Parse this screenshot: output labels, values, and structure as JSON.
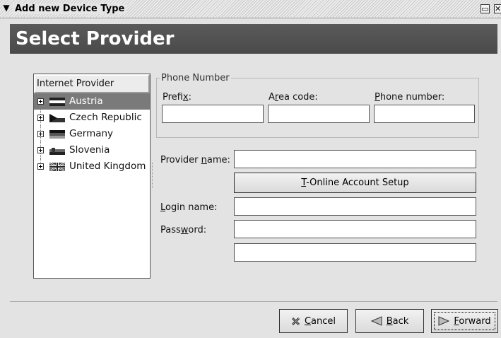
{
  "window": {
    "title": "Add new Device Type",
    "menu_icon": "chevron-down-icon",
    "maximize_icon": "maximize-icon",
    "close_icon": "close-icon"
  },
  "banner": {
    "title": "Select Provider"
  },
  "tree": {
    "header": "Internet Provider",
    "items": [
      {
        "label": "Austria",
        "selected": true,
        "flag": "austria-flag-icon"
      },
      {
        "label": "Czech Republic",
        "selected": false,
        "flag": "czech-flag-icon"
      },
      {
        "label": "Germany",
        "selected": false,
        "flag": "germany-flag-icon"
      },
      {
        "label": "Slovenia",
        "selected": false,
        "flag": "slovenia-flag-icon"
      },
      {
        "label": "United Kingdom",
        "selected": false,
        "flag": "uk-flag-icon"
      }
    ]
  },
  "phone": {
    "legend": "Phone Number",
    "prefix_label": {
      "pre": "Prefi",
      "mn": "x",
      "post": ":"
    },
    "area_label": {
      "pre": "A",
      "mn": "r",
      "post": "ea code:"
    },
    "number_label": {
      "pre": "",
      "mn": "P",
      "post": "hone number:"
    },
    "prefix_value": "",
    "area_value": "",
    "number_value": ""
  },
  "provider": {
    "label": {
      "pre": "Provider ",
      "mn": "n",
      "post": "ame:"
    },
    "value": ""
  },
  "tonline_button": {
    "pre": "",
    "mn": "T",
    "post": "-Online Account Setup"
  },
  "login": {
    "label": {
      "pre": "",
      "mn": "L",
      "post": "ogin name:"
    },
    "value": ""
  },
  "password": {
    "label": {
      "pre": "Pass",
      "mn": "w",
      "post": "ord:"
    },
    "value": "",
    "confirm_value": ""
  },
  "buttons": {
    "cancel": {
      "pre": "",
      "mn": "C",
      "post": "ancel",
      "icon": "cancel-icon"
    },
    "back": {
      "pre": "",
      "mn": "B",
      "post": "ack",
      "icon": "back-arrow-icon"
    },
    "forward": {
      "pre": "",
      "mn": "F",
      "post": "orward",
      "icon": "forward-arrow-icon"
    }
  },
  "colors": {
    "selection": "#7a7a7a",
    "banner": "#505050",
    "dialog_bg": "#e3e3e3"
  }
}
